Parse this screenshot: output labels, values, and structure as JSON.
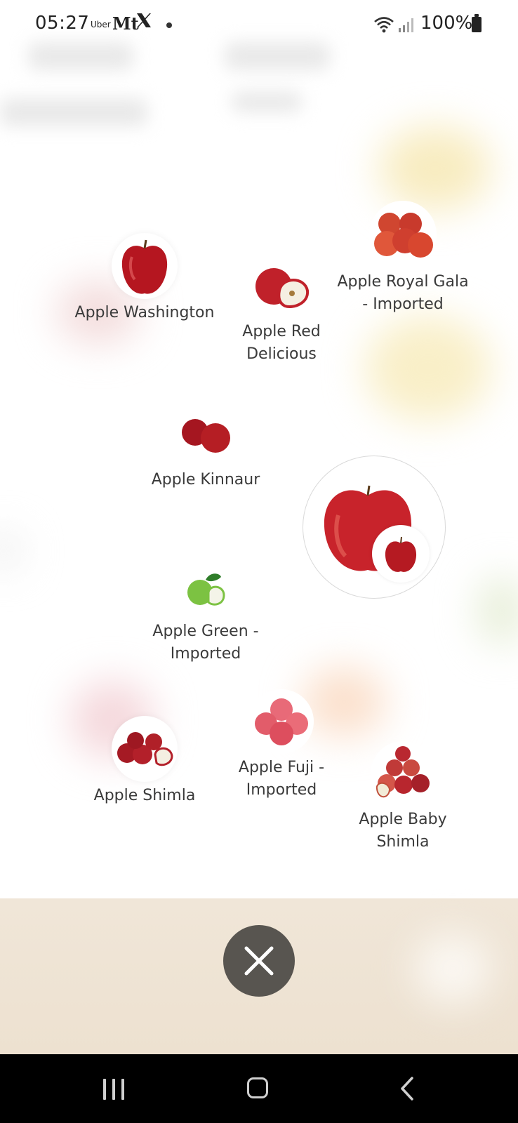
{
  "status_bar": {
    "time": "05:27",
    "notif_uber": "Uber",
    "notif_mt": "Mt",
    "notif_x": "𝕏",
    "battery": "100%"
  },
  "items": [
    {
      "label": "Apple Washington"
    },
    {
      "label": "Apple Red Delicious"
    },
    {
      "label": "Apple Royal Gala - Imported"
    },
    {
      "label": "Apple Kinnaur"
    },
    {
      "label": "Apple Green - Imported"
    },
    {
      "label": "Apple Shimla"
    },
    {
      "label": "Apple Fuji - Imported"
    },
    {
      "label": "Apple Baby Shimla"
    }
  ],
  "colors": {
    "apple_red": "#c0212a",
    "apple_green": "#7cc242",
    "close_button": "#585550",
    "bottom_band": "#efe4d5"
  },
  "icons": {
    "close": "close-icon",
    "nav_recents": "recents-icon",
    "nav_home": "home-icon",
    "nav_back": "back-icon"
  }
}
